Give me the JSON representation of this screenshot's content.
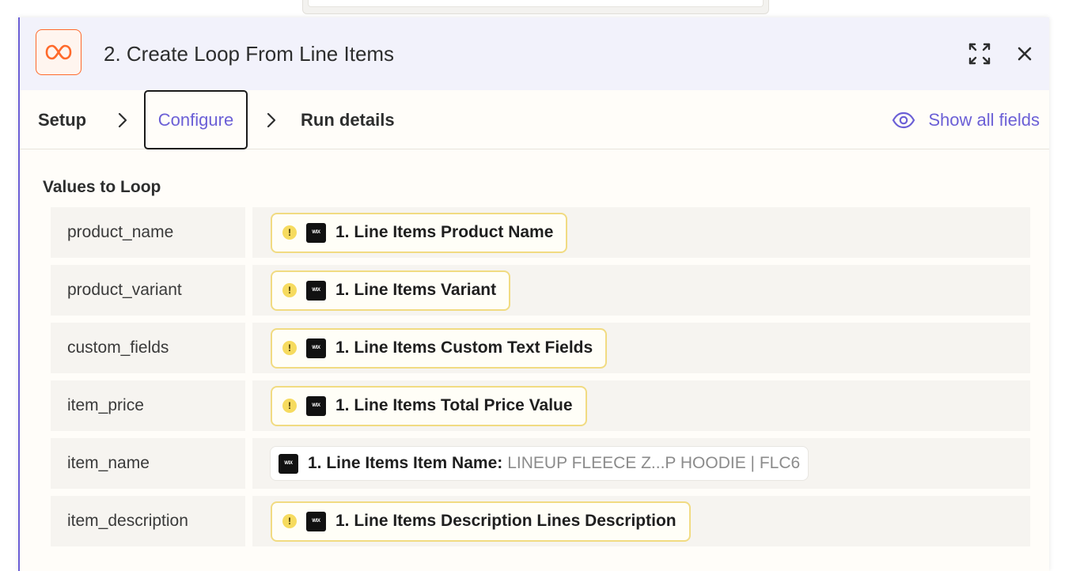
{
  "header": {
    "title": "2. Create Loop From Line Items",
    "app_icon": "loop-icon",
    "accent": "#ff6a2b"
  },
  "tabs": {
    "setup": "Setup",
    "configure": "Configure",
    "run_details": "Run details",
    "show_all_fields": "Show all fields"
  },
  "section": {
    "label": "Values to Loop"
  },
  "rows": [
    {
      "key": "product_name",
      "value": "1. Line Items Product Name",
      "warning": true
    },
    {
      "key": "product_variant",
      "value": "1. Line Items Variant",
      "warning": true
    },
    {
      "key": "custom_fields",
      "value": "1. Line Items Custom Text Fields",
      "warning": true
    },
    {
      "key": "item_price",
      "value": "1. Line Items Total Price Value",
      "warning": true
    },
    {
      "key": "item_name",
      "value": "1. Line Items Item Name:",
      "sample": "LINEUP FLEECE Z...P HOODIE | FLC6",
      "warning": false
    },
    {
      "key": "item_description",
      "value": "1. Line Items Description Lines Description",
      "warning": true
    }
  ],
  "colors": {
    "brand": "#6b5fd6",
    "pill_border": "#f1db82",
    "warning": "#f6db5f"
  }
}
